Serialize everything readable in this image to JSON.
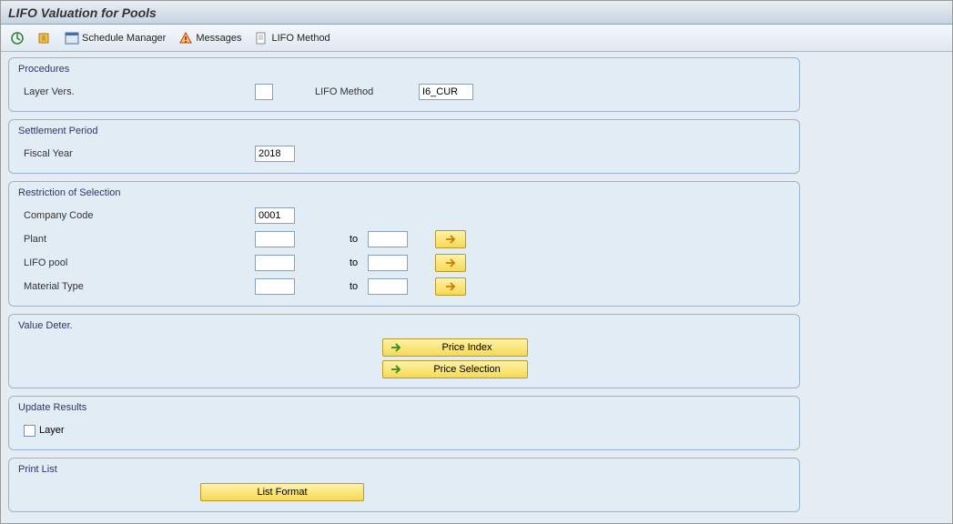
{
  "title": "LIFO Valuation for Pools",
  "toolbar": {
    "schedule_manager": "Schedule Manager",
    "messages": "Messages",
    "lifo_method": "LIFO Method"
  },
  "groups": {
    "procedures": {
      "title": "Procedures",
      "layer_vers": {
        "label": "Layer Vers.",
        "value": ""
      },
      "lifo_method": {
        "label": "LIFO Method",
        "value": "I6_CUR"
      }
    },
    "settlement": {
      "title": "Settlement Period",
      "fiscal_year": {
        "label": "Fiscal Year",
        "value": "2018"
      }
    },
    "restriction": {
      "title": "Restriction of Selection",
      "company_code": {
        "label": "Company Code",
        "value": "0001"
      },
      "plant": {
        "label": "Plant",
        "from": "",
        "to_label": "to",
        "to": ""
      },
      "lifo_pool": {
        "label": "LIFO pool",
        "from": "",
        "to_label": "to",
        "to": ""
      },
      "material_type": {
        "label": "Material Type",
        "from": "",
        "to_label": "to",
        "to": ""
      }
    },
    "value_deter": {
      "title": "Value Deter.",
      "price_index": "Price Index",
      "price_selection": "Price Selection"
    },
    "update_results": {
      "title": "Update Results",
      "layer": "Layer"
    },
    "print_list": {
      "title": "Print List",
      "list_format": "List Format"
    }
  }
}
